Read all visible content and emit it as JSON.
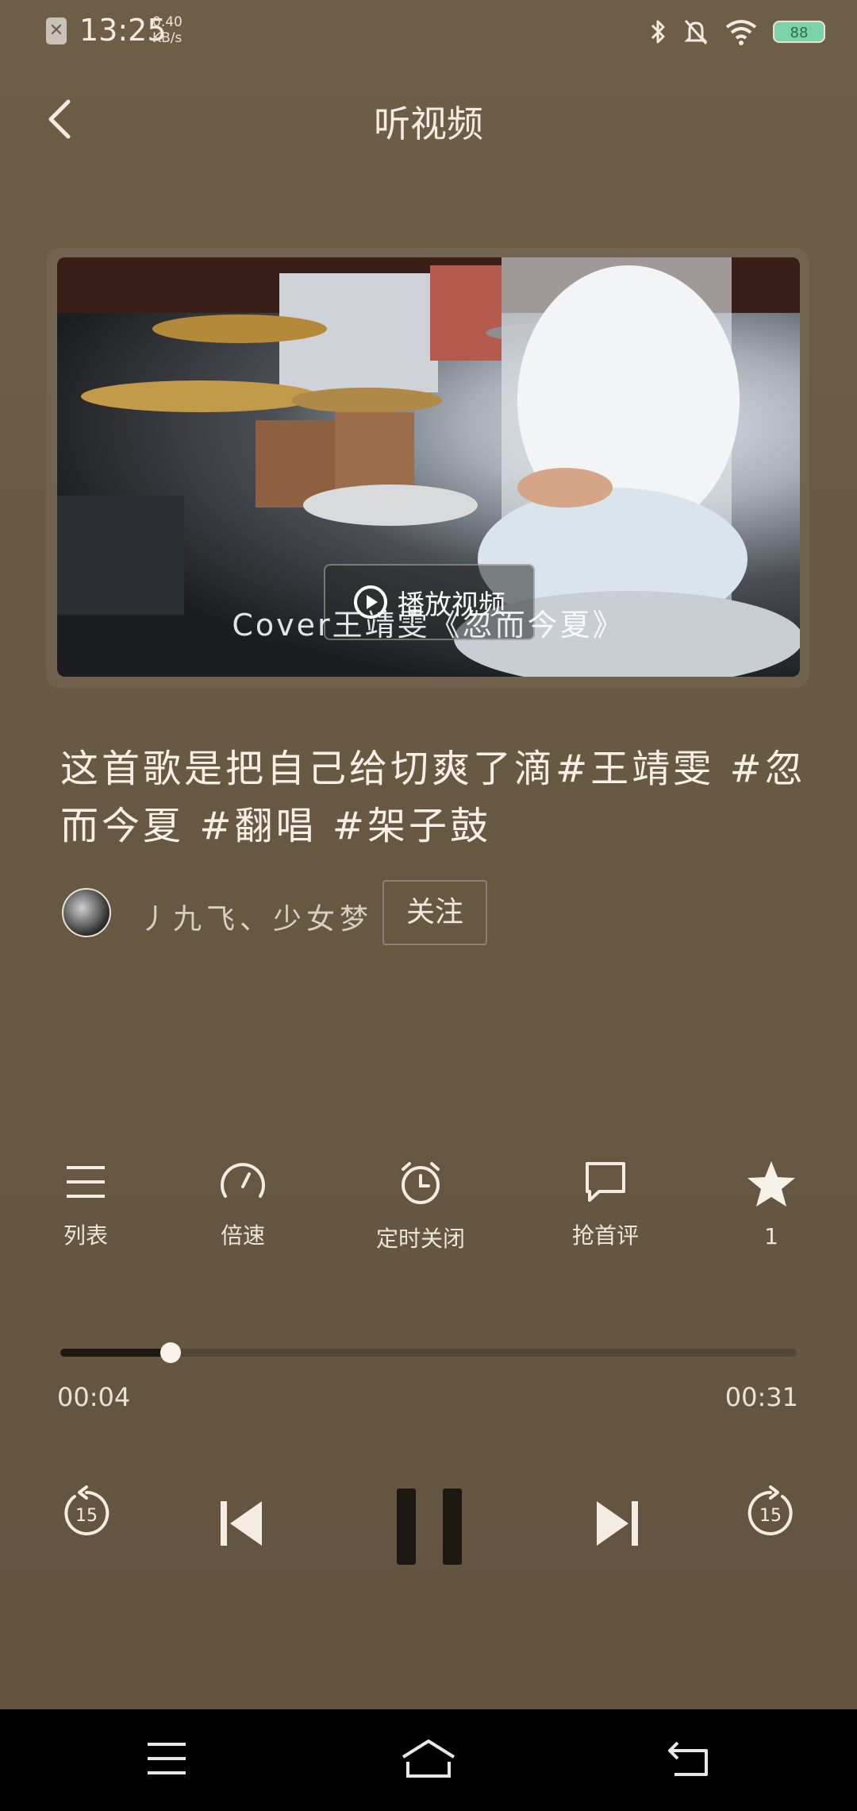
{
  "status_bar": {
    "time": "13:25",
    "net_speed_value": "0.40",
    "net_speed_unit": "KB/s",
    "battery": "88"
  },
  "header": {
    "title": "听视频"
  },
  "video": {
    "play_label": "播放视频",
    "caption": "Cover王靖雯《忽而今夏》"
  },
  "post": {
    "description": "这首歌是把自己给切爽了滴#王靖雯 #忽而今夏 #翻唱 #架子鼓",
    "author": "丿九飞、少女梦",
    "follow_label": "关注"
  },
  "actions": [
    {
      "label": "列表",
      "icon": "list-icon"
    },
    {
      "label": "倍速",
      "icon": "speed-gauge-icon"
    },
    {
      "label": "定时关闭",
      "icon": "alarm-clock-icon"
    },
    {
      "label": "抢首评",
      "icon": "comment-icon"
    },
    {
      "label": "1",
      "icon": "star-icon"
    }
  ],
  "player": {
    "current_time": "00:04",
    "total_time": "00:31",
    "progress_fraction": 0.15
  },
  "colors": {
    "background": "#685943",
    "text": "#f3ece2",
    "battery": "#7dd3a8"
  }
}
